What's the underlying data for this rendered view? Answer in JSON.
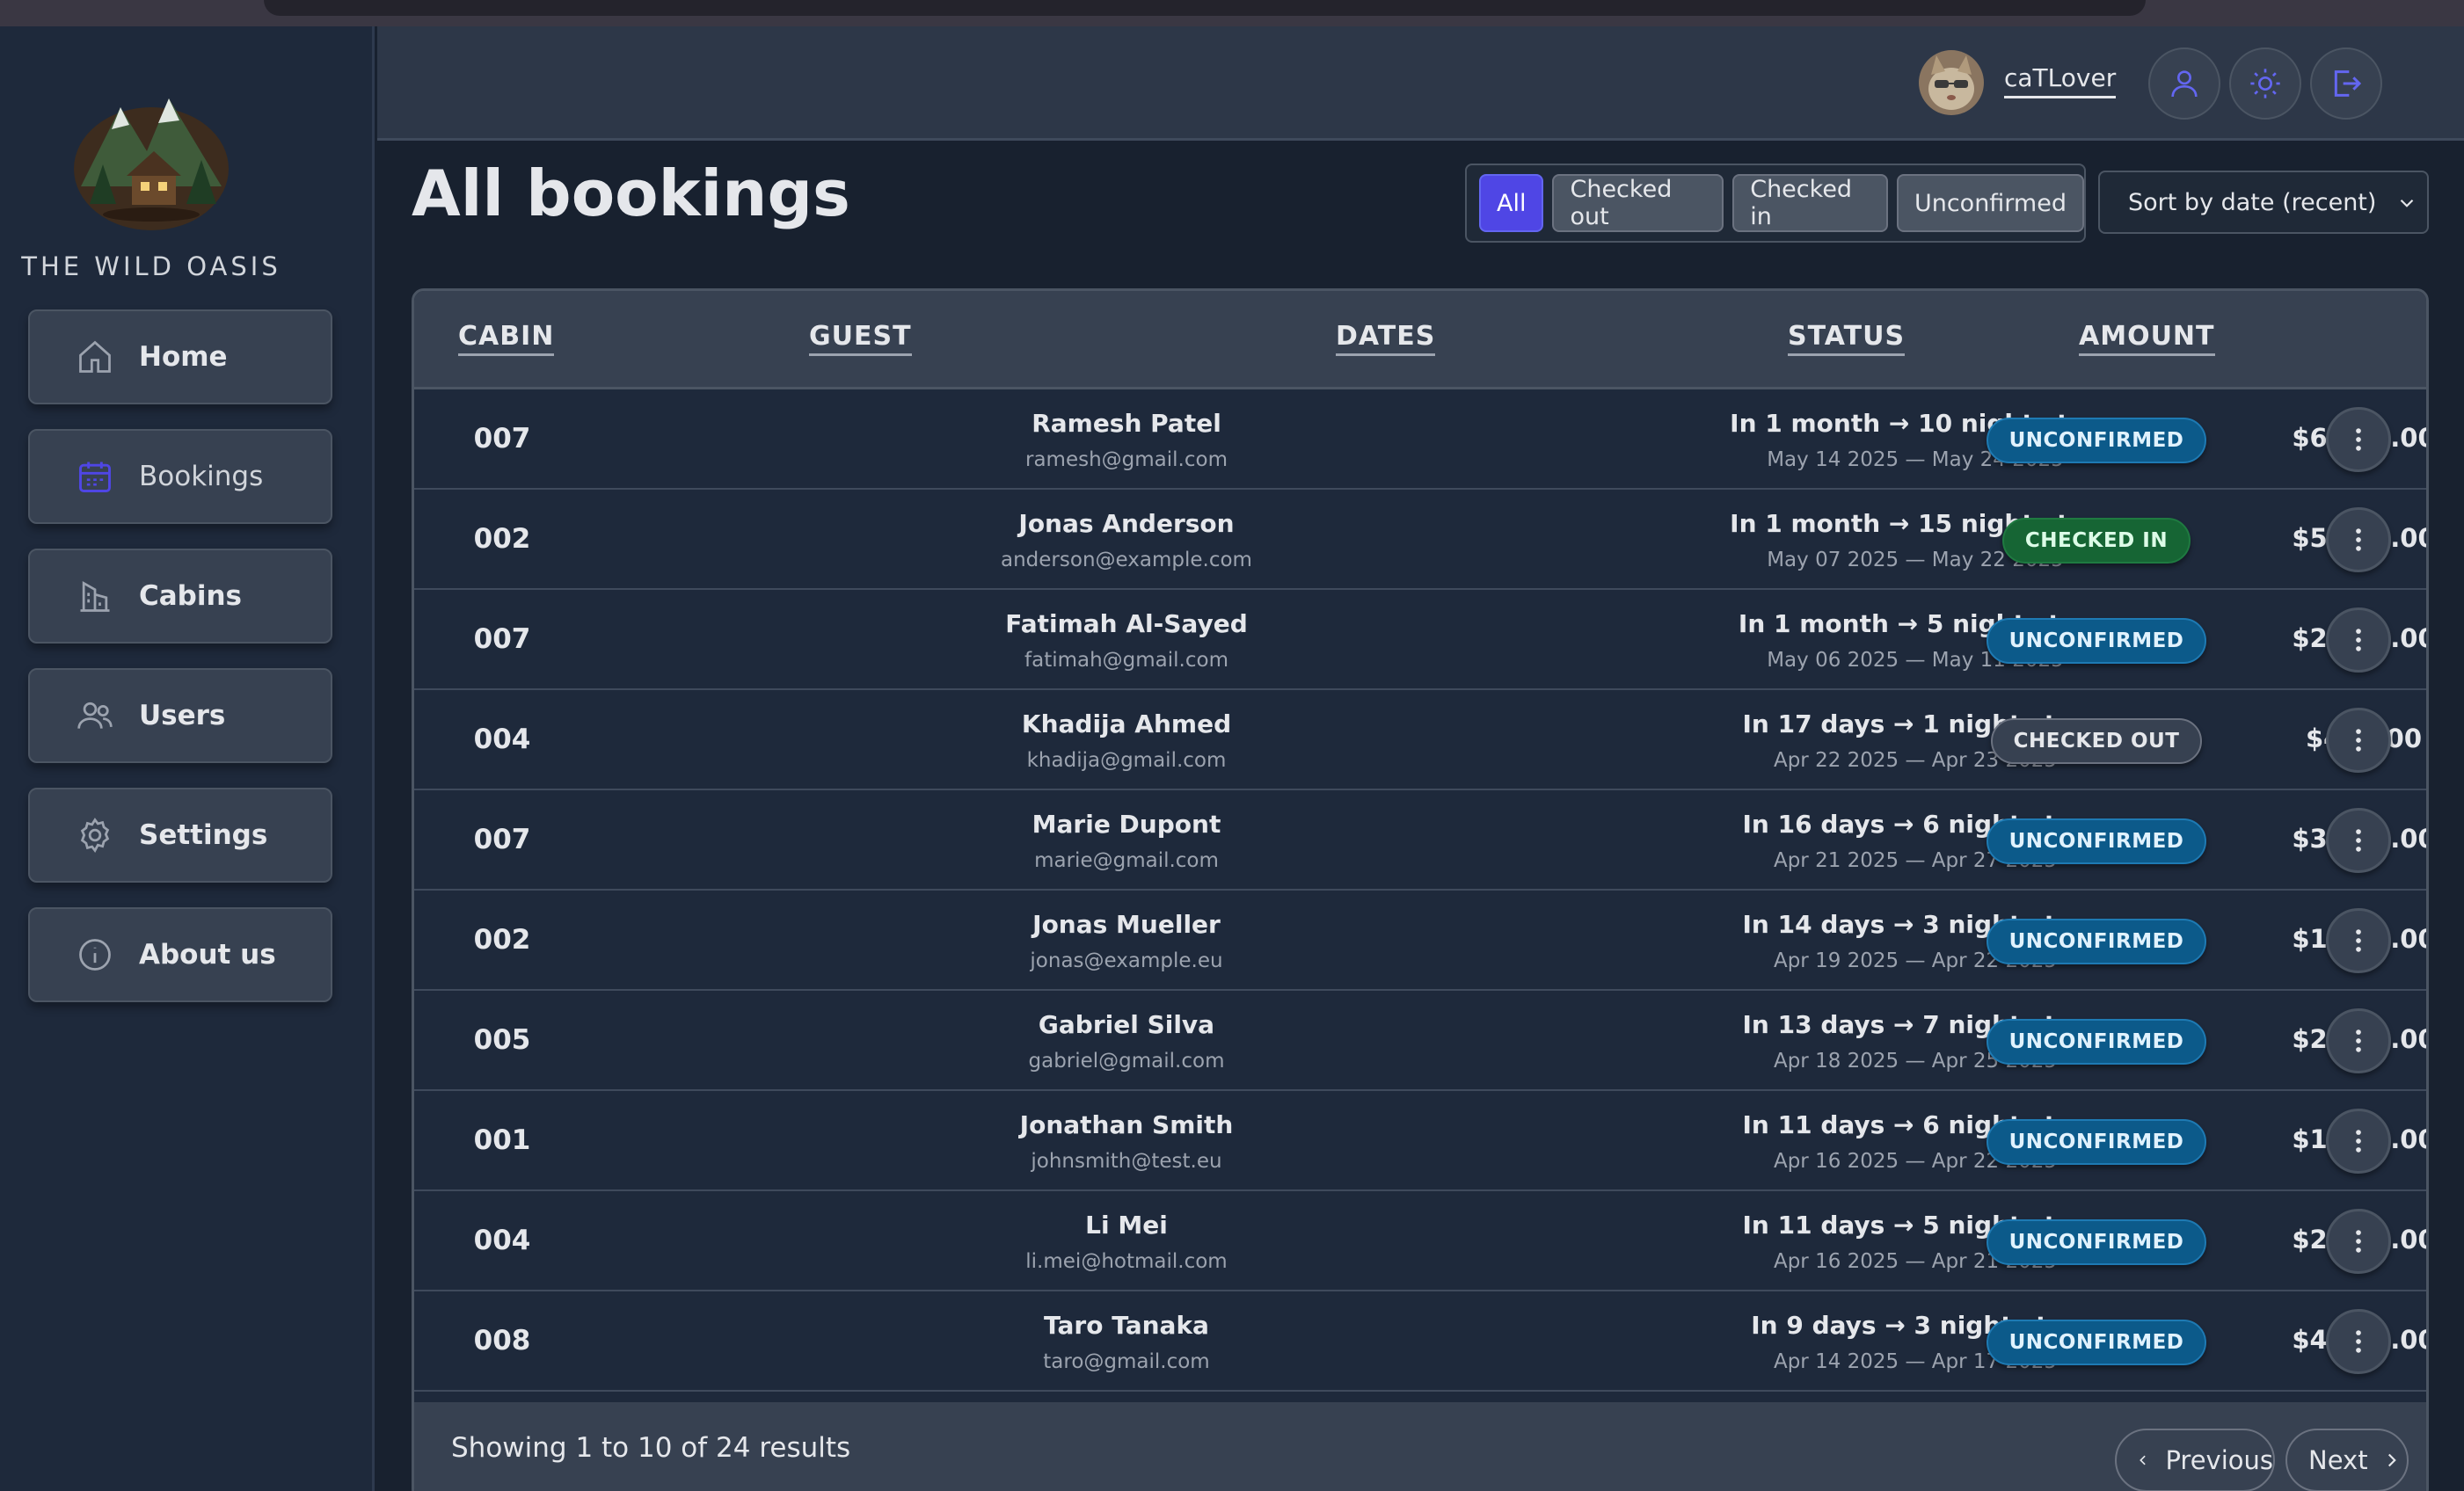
{
  "brand": {
    "name": "THE WILD OASIS"
  },
  "nav": {
    "items": [
      {
        "label": "Home",
        "icon": "home-icon"
      },
      {
        "label": "Bookings",
        "icon": "calendar-icon"
      },
      {
        "label": "Cabins",
        "icon": "building-icon"
      },
      {
        "label": "Users",
        "icon": "users-icon"
      },
      {
        "label": "Settings",
        "icon": "gear-icon"
      },
      {
        "label": "About us",
        "icon": "info-icon"
      }
    ]
  },
  "header": {
    "username": "caTLover"
  },
  "page": {
    "title": "All bookings"
  },
  "filters": {
    "options": [
      "All",
      "Checked out",
      "Checked in",
      "Unconfirmed"
    ],
    "active": "All",
    "sort_value": "Sort by date (recent)"
  },
  "table": {
    "headers": {
      "cabin": "CABIN",
      "guest": "GUEST",
      "dates": "DATES",
      "status": "STATUS",
      "amount": "AMOUNT"
    },
    "rows": [
      {
        "cabin": "007",
        "guest": "Ramesh Patel",
        "email": "ramesh@gmail.com",
        "when": "In 1 month → 10 night stay",
        "range": "May 14 2025 — May 24 2025",
        "status": "UNCONFIRMED",
        "amount": "$6,050.00"
      },
      {
        "cabin": "002",
        "guest": "Jonas Anderson",
        "email": "anderson@example.com",
        "when": "In 1 month → 15 night stay",
        "range": "May 07 2025 — May 22 2025",
        "status": "CHECKED IN",
        "amount": "$5,325.00"
      },
      {
        "cabin": "007",
        "guest": "Fatimah Al-Sayed",
        "email": "fatimah@gmail.com",
        "when": "In 1 month → 5 night stay",
        "range": "May 06 2025 — May 11 2025",
        "status": "UNCONFIRMED",
        "amount": "$2,950.00"
      },
      {
        "cabin": "004",
        "guest": "Khadija Ahmed",
        "email": "khadija@gmail.com",
        "when": "In 17 days → 1 night stay",
        "range": "Apr 22 2025 — Apr 23 2025",
        "status": "CHECKED OUT",
        "amount": "$465.00"
      },
      {
        "cabin": "007",
        "guest": "Marie Dupont",
        "email": "marie@gmail.com",
        "when": "In 16 days → 6 night stay",
        "range": "Apr 21 2025 — Apr 27 2025",
        "status": "UNCONFIRMED",
        "amount": "$3,000.00"
      },
      {
        "cabin": "002",
        "guest": "Jonas Mueller",
        "email": "jonas@example.eu",
        "when": "In 14 days → 3 night stay",
        "range": "Apr 19 2025 — Apr 22 2025",
        "status": "UNCONFIRMED",
        "amount": "$1,065.00"
      },
      {
        "cabin": "005",
        "guest": "Gabriel Silva",
        "email": "gabriel@gmail.com",
        "when": "In 13 days → 7 night stay",
        "range": "Apr 18 2025 — Apr 25 2025",
        "status": "UNCONFIRMED",
        "amount": "$2,975.00"
      },
      {
        "cabin": "001",
        "guest": "Jonathan Smith",
        "email": "johnsmith@test.eu",
        "when": "In 11 days → 6 night stay",
        "range": "Apr 16 2025 — Apr 22 2025",
        "status": "UNCONFIRMED",
        "amount": "$1,500.00"
      },
      {
        "cabin": "004",
        "guest": "Li Mei",
        "email": "li.mei@hotmail.com",
        "when": "In 11 days → 5 night stay",
        "range": "Apr 16 2025 — Apr 21 2025",
        "status": "UNCONFIRMED",
        "amount": "$2,550.00"
      },
      {
        "cabin": "008",
        "guest": "Taro Tanaka",
        "email": "taro@gmail.com",
        "when": "In 9 days → 3 night stay",
        "range": "Apr 14 2025 — Apr 17 2025",
        "status": "UNCONFIRMED",
        "amount": "$4,200.00"
      }
    ]
  },
  "pagination": {
    "summary": "Showing 1 to 10 of 24 results",
    "previous": "Previous",
    "next": "Next"
  },
  "colors": {
    "accent": "#4f46e5",
    "unconfirmed": "#0c5a8a",
    "checked_in": "#166534",
    "checked_out": "#374151",
    "background": "#18212f"
  }
}
